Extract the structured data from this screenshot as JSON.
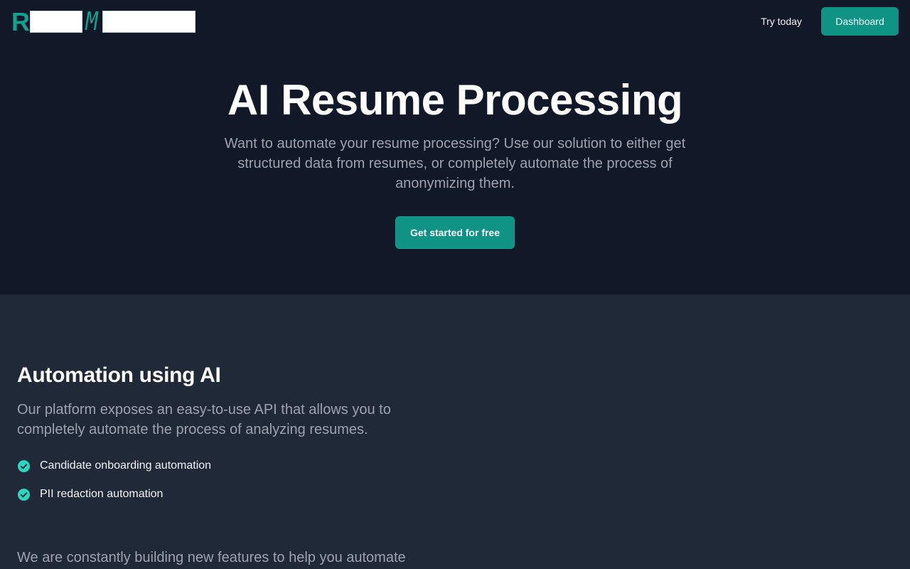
{
  "header": {
    "logo": {
      "letter_1": "R",
      "letter_2": "M"
    },
    "nav_link_label": "Try today",
    "nav_button_label": "Dashboard"
  },
  "hero": {
    "title": "AI Resume Processing",
    "subtitle": "Want to automate your resume processing? Use our solution to either get structured data from resumes, or completely automate the process of anonymizing them.",
    "cta_label": "Get started for free"
  },
  "section": {
    "title": "Automation using AI",
    "description": "Our platform exposes an easy-to-use API that allows you to completely automate the process of analyzing resumes.",
    "features": [
      {
        "label": "Candidate onboarding automation",
        "icon": "check-circle-icon"
      },
      {
        "label": "PII redaction automation",
        "icon": "check-circle-icon"
      }
    ],
    "more_text": "We are constantly building new features to help you automate"
  },
  "colors": {
    "page_background": "#111827",
    "section_background": "#1f2937",
    "accent": "#0f9384",
    "check": "#2dd4bf"
  }
}
